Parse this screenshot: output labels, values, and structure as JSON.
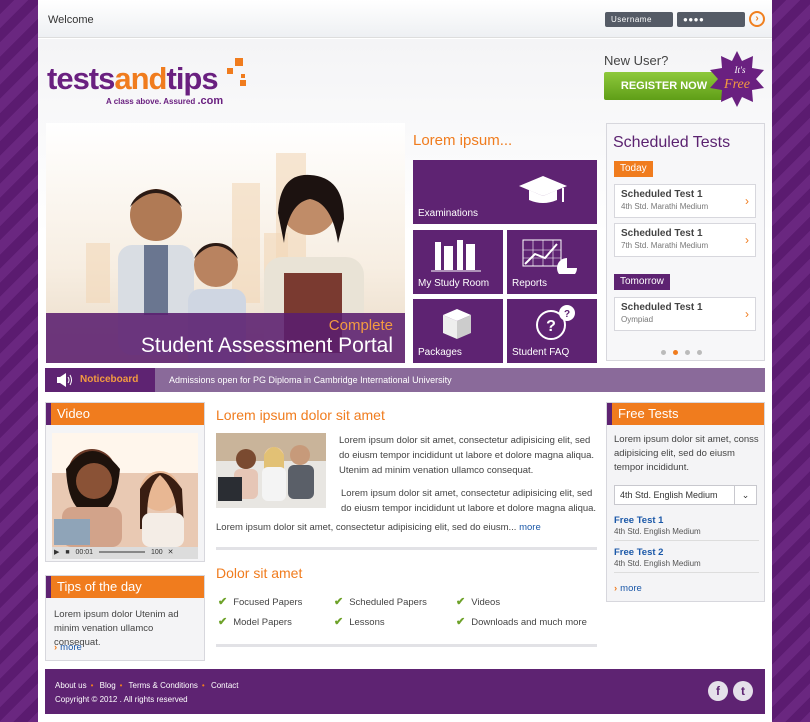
{
  "header": {
    "welcome": "Welcome",
    "username": "Username",
    "password": "●●●●"
  },
  "brand": {
    "logo_left": "tests",
    "logo_mid": "and",
    "logo_right": "tips",
    "tagline": "A class above. Assured",
    "domain": ".com"
  },
  "register": {
    "question": "New User?",
    "button": "REGISTER NOW",
    "badge_top": "It's",
    "badge_bottom": "Free"
  },
  "banner": {
    "line1": "Complete",
    "line2": "Student Assessment Portal"
  },
  "tiles": {
    "heading": "Lorem ipsum...",
    "examinations": "Examinations",
    "study": "My Study Room",
    "reports": "Reports",
    "packages": "Packages",
    "faq": "Student FAQ"
  },
  "scheduled": {
    "title": "Scheduled Tests",
    "today": "Today",
    "tomorrow": "Tomorrow",
    "items": [
      {
        "name": "Scheduled Test 1",
        "sub": "4th Std. Marathi Medium"
      },
      {
        "name": "Scheduled Test 1",
        "sub": "7th Std. Marathi Medium"
      },
      {
        "name": "Scheduled Test 1",
        "sub": "Oympiad"
      }
    ]
  },
  "noticeboard": {
    "label": "Noticeboard",
    "text": "Admissions open for PG Diploma in Cambridge International University"
  },
  "video": {
    "title": "Video",
    "time": "00:01",
    "volume": "100"
  },
  "tips": {
    "title": "Tips of the day",
    "text": "Lorem ipsum dolor Utenim ad minim venation ullamco consequat.",
    "more": "more"
  },
  "main": {
    "title": "Lorem ipsum dolor sit amet",
    "p1": "Lorem ipsum dolor sit amet, consectetur adipisicing elit, sed do eiusm tempor incididunt ut labore et dolore magna aliqua. Utenim ad minim venation ullamco consequat.",
    "p2": "Lorem ipsum dolor sit amet, consectetur adipisicing elit, sed do eiusm tempor incididunt ut labore et dolore magna aliqua.",
    "p3": "Lorem ipsum dolor sit amet, consectetur adipisicing elit, sed do eiusm...",
    "more": "more",
    "title2": "Dolor sit amet",
    "features": [
      "Focused Papers",
      "Scheduled Papers",
      "Videos",
      "Model Papers",
      "Lessons",
      "Downloads and much more"
    ]
  },
  "free": {
    "title": "Free Tests",
    "text": "Lorem ipsum dolor sit amet, conss adipisicing elit, sed do eiusm tempor incididunt.",
    "select": "4th Std. English Medium",
    "items": [
      {
        "name": "Free Test 1",
        "sub": "4th Std. English Medium"
      },
      {
        "name": "Free Test 2",
        "sub": "4th Std. English Medium"
      }
    ],
    "more": "more"
  },
  "footer": {
    "links": [
      "About us",
      "Blog",
      "Terms & Conditions",
      "Contact"
    ],
    "copyright": "Copyright © 2012 . All rights reserved"
  },
  "colors": {
    "purple": "#5e2372",
    "orange": "#f07c1e",
    "green": "#6ea22a"
  }
}
